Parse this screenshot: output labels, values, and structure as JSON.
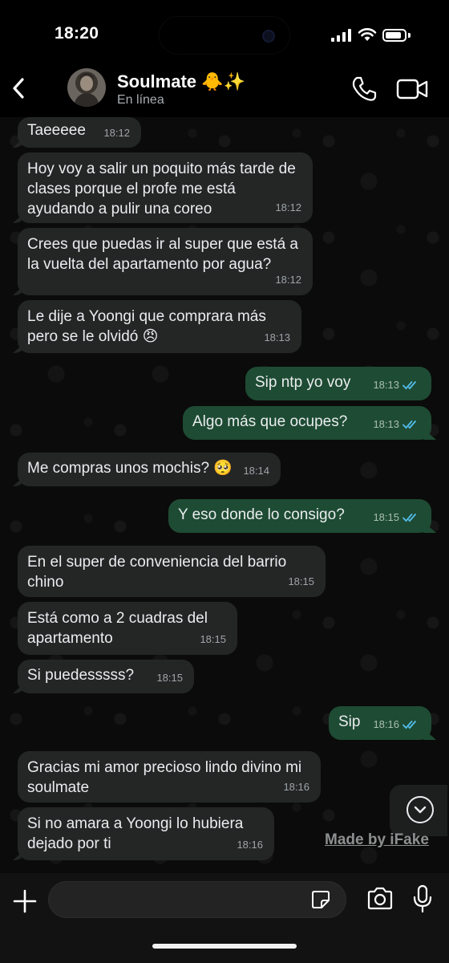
{
  "status_bar": {
    "time": "18:20",
    "battery_level": 0.85
  },
  "header": {
    "back_icon": "chevron-left-icon",
    "contact_name": "Soulmate 🐥✨",
    "contact_status": "En línea",
    "call_icon": "phone-icon",
    "video_icon": "video-camera-icon"
  },
  "messages": [
    {
      "direction": "in",
      "text": "Taeeeee",
      "time": "18:12"
    },
    {
      "direction": "in",
      "text": "Hoy voy a salir un poquito más tarde de clases porque el profe me está ayudando a pulir una coreo",
      "time": "18:12"
    },
    {
      "direction": "in",
      "text": "Crees que puedas ir al super que está a la vuelta del apartamento por agua?",
      "time": "18:12"
    },
    {
      "direction": "in",
      "text": "Le dije a Yoongi que comprara más pero se le olvidó 😠",
      "time": "18:13"
    },
    {
      "direction": "out",
      "text": "Sip ntp yo voy",
      "time": "18:13",
      "status": "read"
    },
    {
      "direction": "out",
      "text": "Algo más que ocupes?",
      "time": "18:13",
      "status": "read"
    },
    {
      "direction": "in",
      "text": "Me compras unos mochis? 🥺",
      "time": "18:14"
    },
    {
      "direction": "out",
      "text": "Y eso donde lo consigo?",
      "time": "18:15",
      "status": "read"
    },
    {
      "direction": "in",
      "text": "En el super de conveniencia del barrio chino",
      "time": "18:15"
    },
    {
      "direction": "in",
      "text": "Está como a 2 cuadras del apartamento",
      "time": "18:15"
    },
    {
      "direction": "in",
      "text": "Si puedesssss?",
      "time": "18:15"
    },
    {
      "direction": "out",
      "text": "Sip",
      "time": "18:16",
      "status": "read"
    },
    {
      "direction": "in",
      "text": "Gracias mi amor precioso lindo divino mi soulmate",
      "time": "18:16"
    },
    {
      "direction": "in",
      "text": "Si no amara a Yoongi lo hubiera dejado por ti",
      "time": "18:16"
    }
  ],
  "scroll_down_icon": "chevron-down-icon",
  "watermark": "Made by iFake",
  "input_bar": {
    "plus_icon": "plus-icon",
    "message_value": "",
    "placeholder": "",
    "sticker_icon": "sticker-icon",
    "camera_icon": "camera-icon",
    "mic_icon": "microphone-icon"
  },
  "colors": {
    "incoming_bubble": "#242626",
    "outgoing_bubble": "#1e4b33",
    "read_ticks": "#53bdeb",
    "background": "#0b0b0b"
  }
}
